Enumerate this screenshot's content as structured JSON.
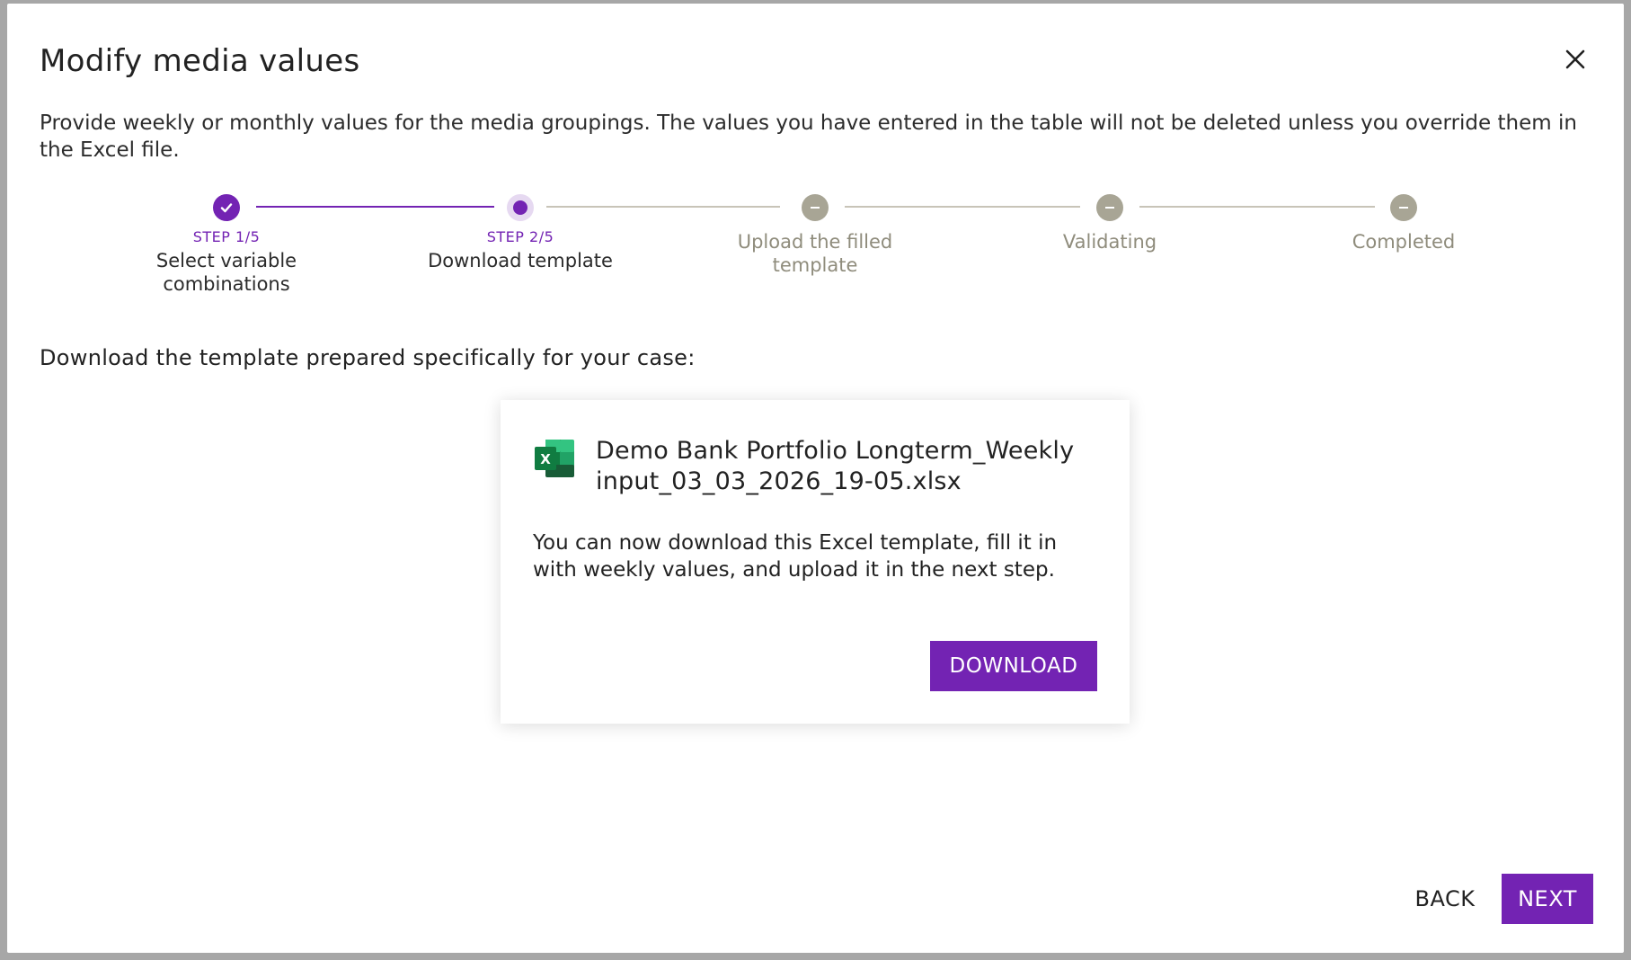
{
  "modal": {
    "title": "Modify media values",
    "description": "Provide weekly or monthly values for the media groupings. The values you have entered in the table will not be deleted unless you override them in the Excel file."
  },
  "stepper": {
    "steps": [
      {
        "kicker": "STEP 1/5",
        "label": "Select variable combinations",
        "state": "done"
      },
      {
        "kicker": "STEP 2/5",
        "label": "Download template",
        "state": "active"
      },
      {
        "kicker": "",
        "label": "Upload the filled template",
        "state": "pending"
      },
      {
        "kicker": "",
        "label": "Validating",
        "state": "pending"
      },
      {
        "kicker": "",
        "label": "Completed",
        "state": "pending"
      }
    ]
  },
  "instruction": "Download the template prepared specifically for your case:",
  "card": {
    "file_name": "Demo Bank Portfolio Longterm_Weekly input_03_03_2026_19-05.xlsx",
    "text": "You can now download this Excel template, fill it in with weekly values, and upload it in the next step.",
    "download_label": "DOWNLOAD",
    "icon": "excel-file-icon"
  },
  "footer": {
    "back_label": "BACK",
    "next_label": "NEXT"
  },
  "colors": {
    "accent": "#7323b3",
    "pending": "#a8a595"
  }
}
